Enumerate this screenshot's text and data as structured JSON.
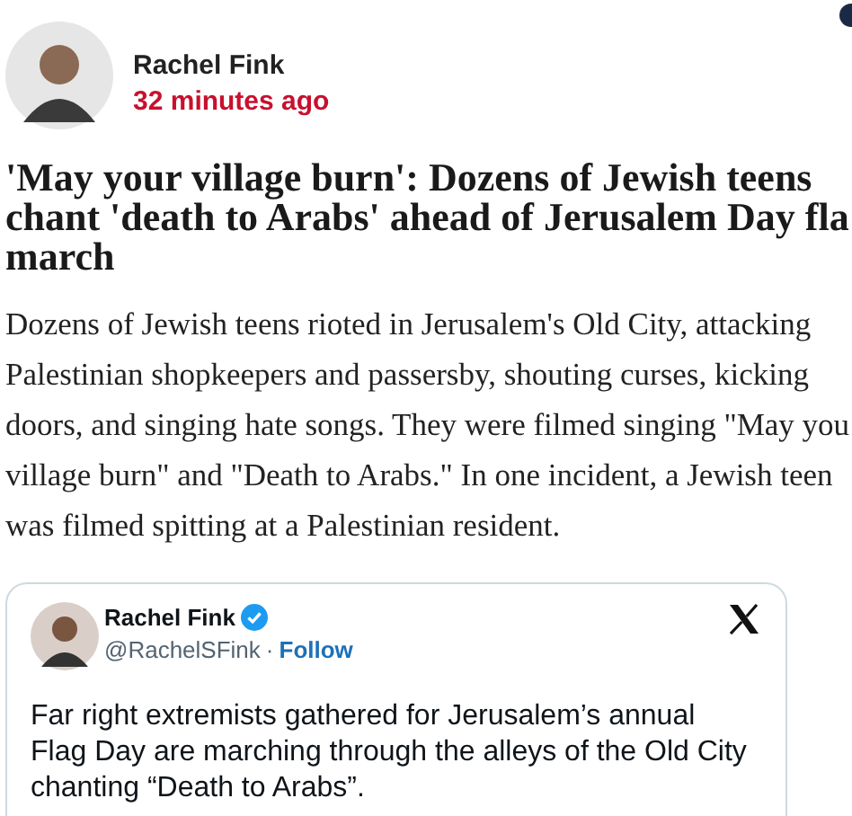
{
  "author": {
    "name": "Rachel Fink",
    "time": "32 minutes ago"
  },
  "headline": {
    "lines": [
      "'May your village burn': Dozens of Jewish teens",
      "chant 'death to Arabs' ahead of Jerusalem Day fla",
      "march"
    ]
  },
  "body": {
    "lines": [
      "Dozens of Jewish teens rioted in Jerusalem's Old City, attacking",
      "Palestinian shopkeepers and passersby, shouting curses, kicking",
      "doors, and singing hate songs. They were filmed singing \"May you",
      "village burn\" and \"Death to Arabs.\" In one incident, a Jewish teen",
      "was filmed spitting at a Palestinian resident."
    ]
  },
  "tweet": {
    "name": "Rachel Fink",
    "verified": true,
    "handle": "@RachelSFink",
    "separator": "·",
    "follow": "Follow",
    "text": "Far right extremists gathered for Jerusalem’s annual Flag Day are marching through the alleys of the Old City chanting “Death to Arabs”."
  }
}
